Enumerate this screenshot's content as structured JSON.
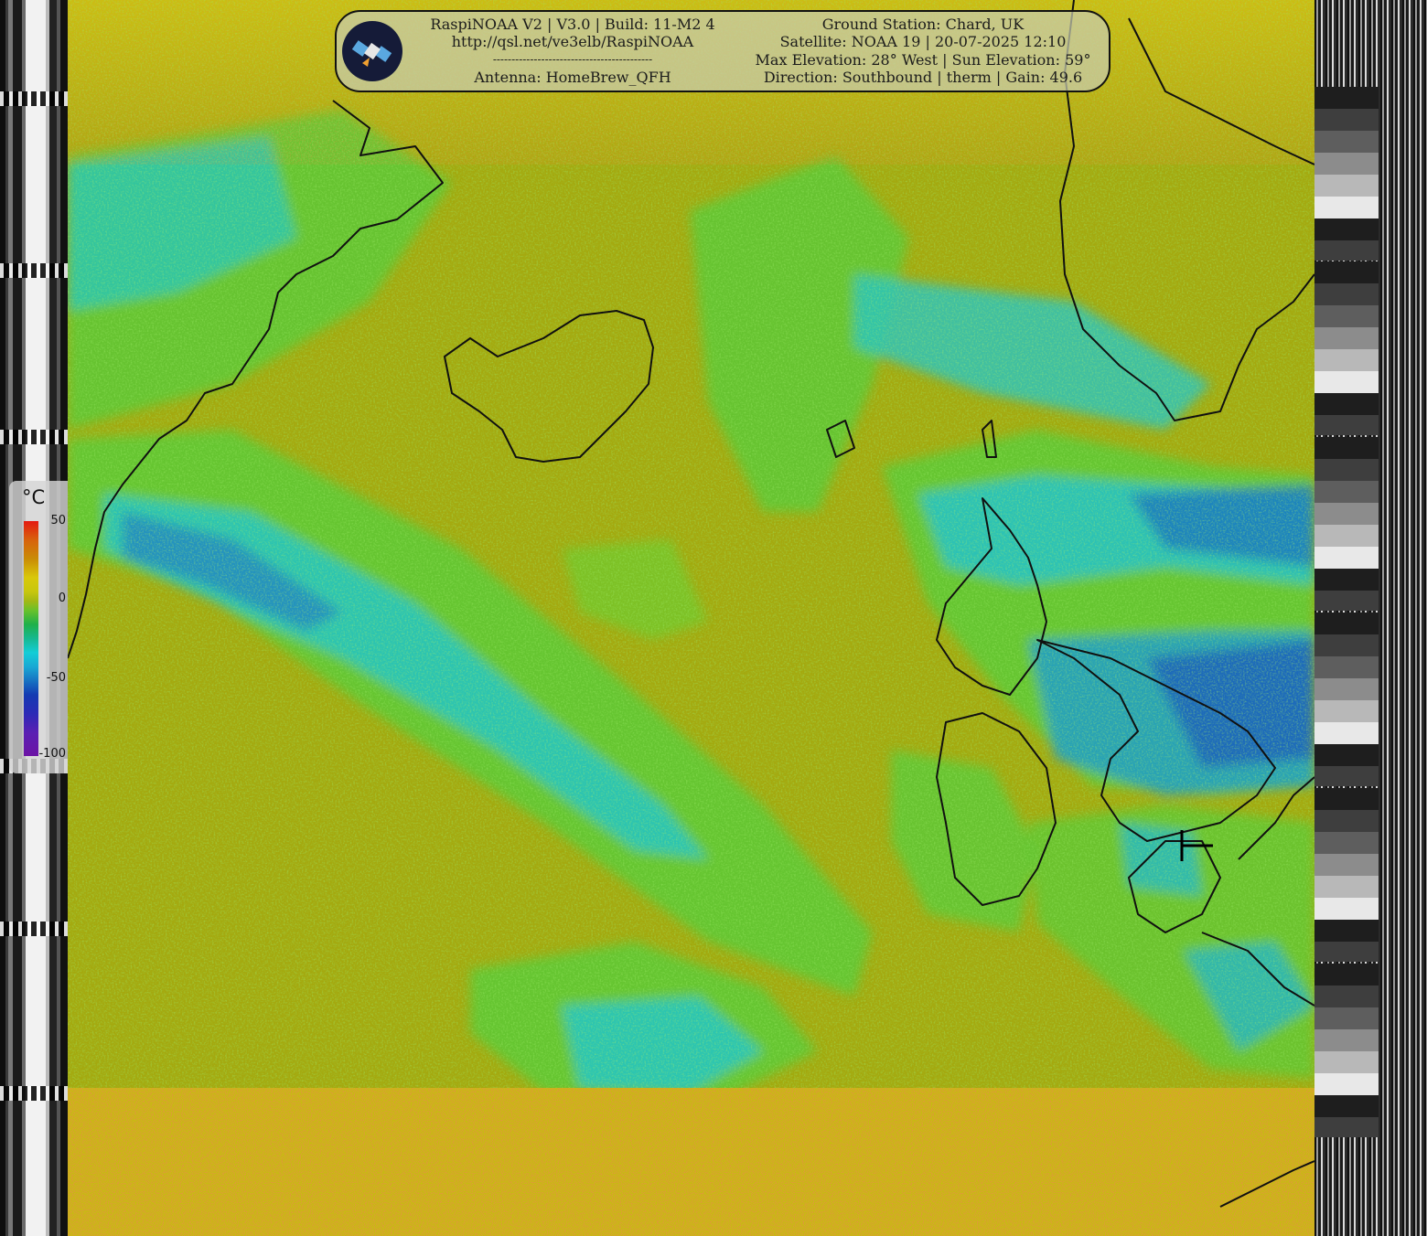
{
  "header": {
    "left_lines": [
      "RaspiNOAA V2 | V3.0 | Build: 11-M2 4",
      "http://qsl.net/ve3elb/RaspiNOAA",
      "-------------------------------------------",
      "Antenna: HomeBrew_QFH"
    ],
    "right_lines": [
      "Ground Station: Chard, UK",
      "Satellite: NOAA 19 | 20-07-2025 12:10",
      "Max Elevation: 28° West | Sun Elevation: 59°",
      "Direction: Southbound | therm | Gain: 49.6"
    ]
  },
  "legend": {
    "unit": "°C",
    "ticks": [
      "50",
      "0",
      "-50",
      "-100"
    ]
  },
  "icons": {
    "logo": "satellite-icon",
    "station_marker": "crosshair-icon"
  },
  "colors": {
    "ocean_base": "#a6ab0e",
    "cloud_green": "#6ec92a",
    "cloud_cyan": "#25c6c9",
    "cloud_blue": "#1b78c2",
    "noise_red": "#c24a0c",
    "coastline": "#101010",
    "banner_bg": "#c8ccb0"
  }
}
